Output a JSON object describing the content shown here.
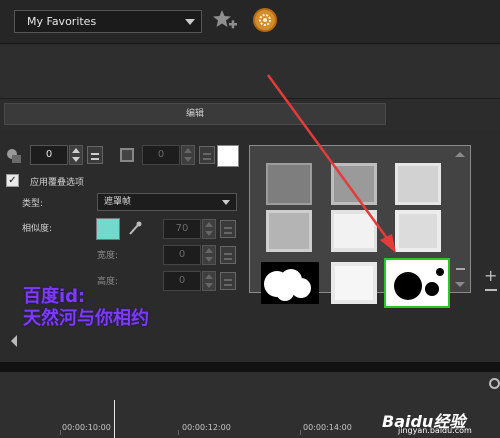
{
  "toolbar": {
    "favorites_label": "My Favorites",
    "star_icon": "star-add-icon",
    "gear_icon": "gear-icon"
  },
  "tab": {
    "edit_label": "编辑"
  },
  "settings": {
    "shape_value": "0",
    "frame_value": "0",
    "overlay_label": "应用覆叠选项",
    "type_label": "类型:",
    "type_value": "遮罩帧",
    "similarity_label": "相似度:",
    "similarity_value": "70",
    "width_label": "宽度:",
    "width_value": "0",
    "height_label": "高度:",
    "height_value": "0",
    "similarity_color": "#73d9cd",
    "swatch_color": "#ffffff"
  },
  "watermark": {
    "line1": "百度id:",
    "line2": "天然河与你相约"
  },
  "timeline": {
    "marks": [
      "00:00:10:00",
      "00:00:12:00",
      "00:00:14:00"
    ]
  },
  "branding": {
    "logo_text": "Baidu经验",
    "url": "jingyan.baidu.com"
  },
  "colors": {
    "selection": "#22cc22",
    "arrow": "#e43b3b",
    "watermark": "#7b3cff"
  }
}
